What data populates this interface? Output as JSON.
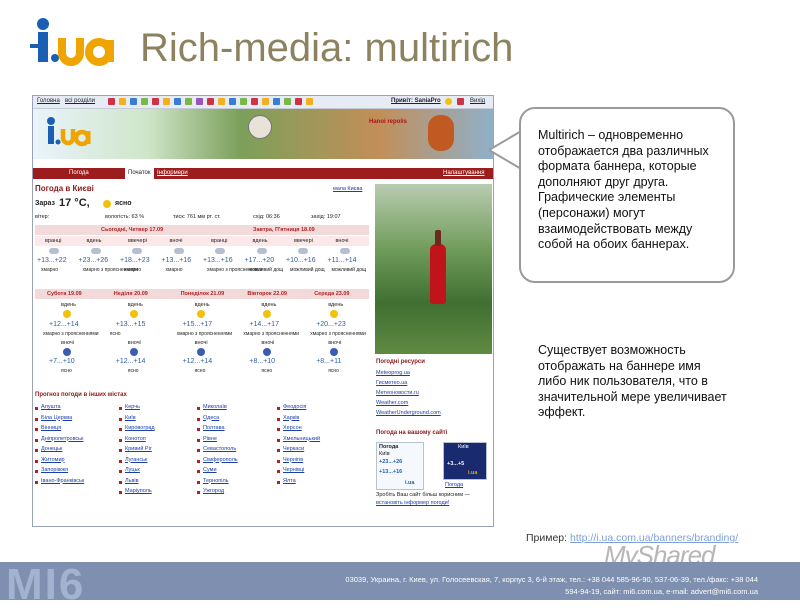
{
  "slide": {
    "logo_text": "i.ua",
    "title": "Rich-media: multirich",
    "callout": "Multirich – одновременно отображается два различных формата баннера, которые дополняют друг друга. Графические элементы (персонажи) могут взаимодействовать между собой на обоих баннерах.",
    "note": "Существует возможность отображать на баннере имя либо ник пользователя, что в значительной мере увеличивает эффект.",
    "example_label": "Пример:",
    "example_link": "http://i.ua.com.ua/banners/branding/",
    "watermark": "MyShared",
    "footer_logo": "MI6",
    "footer_line1": "03039, Украина, г. Киев, ул. Голосеевская, 7, корпус 3, 6-й этаж, тел.: +38 044 585-96-90, 537-06-39, тел./факс: +38 044",
    "footer_line2": "594-94-19, сайт: mi6.com.ua, e-mail: advert@mi6.com.ua"
  },
  "screenshot": {
    "toolbar": {
      "home": "Головна",
      "all": "всі розділи",
      "greeting": "Привіт: SaniaPro",
      "exit": "Вихід"
    },
    "banner_text": "Hanoi repolis",
    "nav": {
      "active": "Погода",
      "tab1": "Початок",
      "tab2": "Інформери",
      "settings": "Налаштування"
    },
    "weather_title": "Погода в Києві",
    "map_link": "мапа Києва",
    "now_label": "Зараз",
    "now_temp": "17 °C,",
    "now_cond": "ясно",
    "stats": [
      "вітер:",
      "вологість: 63 %",
      "тиск: 761 мм рт. ст.",
      "схід: 06:36",
      "захід: 19:07"
    ],
    "today": "Сьогодні, Четвер 17.09",
    "tomorrow": "Завтра, П'ятниця 18.09",
    "dayparts": [
      "вранці",
      "вдень",
      "ввечері",
      "вночі",
      "вранці",
      "вдень",
      "ввечері",
      "вночі"
    ],
    "temps_top": [
      "+13...+22",
      "+23...+26",
      "+18...+23",
      "+13...+16",
      "+13...+16",
      "+17...+20",
      "+10...+16",
      "+11...+14"
    ],
    "conds_top": [
      "хмарно",
      "хмарно з проясненнями",
      "хмарно",
      "хмарно",
      "хмарно з проясненнями",
      "можливий дощ",
      "можливий дощ",
      "можливий дощ"
    ],
    "days": [
      "Субота 19.09",
      "Неділя 20.09",
      "Понеділок 21.09",
      "Вівторок 22.09",
      "Середа 23.09"
    ],
    "day_label": "вдень",
    "night_label": "вночі",
    "temps_day": [
      "+12...+14",
      "+13...+15",
      "+15...+17",
      "+14...+17",
      "+20...+23"
    ],
    "conds_day": [
      "хмарно з проясненнями",
      "ясно",
      "хмарно з проясненнями",
      "хмарно з проясненнями",
      "хмарно з проясненнями"
    ],
    "temps_night": [
      "+7...+10",
      "+12...+14",
      "+12...+14",
      "+8...+10",
      "+8...+11"
    ],
    "conds_night": [
      "ясно",
      "ясно",
      "ясно",
      "ясно",
      "ясно"
    ],
    "other_cities_title": "Прогноз погоди в інших містах",
    "cities_col1": [
      "Алушта",
      "Біла Церква",
      "Вінниця",
      "Дніпропетровськ",
      "Донецьк",
      "Житомир",
      "Запоріжжя",
      "Івано-Франківськ"
    ],
    "cities_col2": [
      "Керчь",
      "Київ",
      "Кировоград",
      "Конотоп",
      "Кривий Ріг",
      "Луганськ",
      "Луцьк",
      "Львів",
      "Маріуполь"
    ],
    "cities_col3": [
      "Миколаїв",
      "Одеса",
      "Полтава",
      "Рівне",
      "Севастополь",
      "Сімферополь",
      "Суми",
      "Тернопіль",
      "Ужгород"
    ],
    "cities_col4": [
      "Феодосія",
      "Харків",
      "Херсон",
      "Хмельницький",
      "Черкаси",
      "Чернігів",
      "Чернівці",
      "Ялта"
    ],
    "resources_title": "Погодні ресурси",
    "resources": [
      "Meteoprog.ua",
      "Гисметео.ua",
      "Метеоновости.ru",
      "Weather.com",
      "WeatherUnderground.com"
    ],
    "your_site_title": "Погода на вашому сайті",
    "widget1": {
      "title": "Погода",
      "city": "Київ",
      "t1": "+23...+26",
      "t2": "+13...+16",
      "brand": "i.ua"
    },
    "widget2": {
      "city": "Київ",
      "t": "+3...+5",
      "brand": "i.ua"
    },
    "widget_caption": "Погода",
    "promo": "Зробіть Ваш сайт більш корисним —",
    "promo_link": "встановіть інформер погоди!"
  }
}
